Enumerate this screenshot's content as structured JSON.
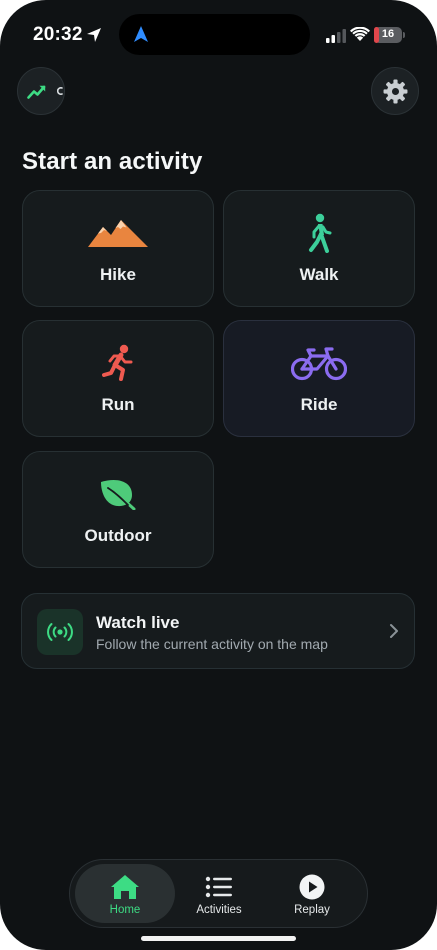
{
  "status_bar": {
    "time": "20:32",
    "battery_level": "16",
    "battery_fraction": 0.16
  },
  "header": {
    "stats_icon": "trend-up-icon",
    "settings_icon": "gear-icon"
  },
  "section_title": "Start an activity",
  "activities": [
    {
      "label": "Hike",
      "icon": "mountains-icon",
      "color": "#e9853f"
    },
    {
      "label": "Walk",
      "icon": "walking-person-icon",
      "color": "#3ccf9a"
    },
    {
      "label": "Run",
      "icon": "running-person-icon",
      "color": "#ef5a50"
    },
    {
      "label": "Ride",
      "icon": "bicycle-icon",
      "color": "#8b6cf0"
    },
    {
      "label": "Outdoor",
      "icon": "leaf-icon",
      "color": "#4ecb7a"
    }
  ],
  "watch_live": {
    "title": "Watch live",
    "subtitle": "Follow the current activity on the map",
    "icon": "broadcast-icon"
  },
  "tabbar": {
    "tabs": [
      {
        "label": "Home",
        "icon": "house-icon",
        "active": true
      },
      {
        "label": "Activities",
        "icon": "list-icon",
        "active": false
      },
      {
        "label": "Replay",
        "icon": "play-circle-icon",
        "active": false
      }
    ]
  },
  "colors": {
    "background": "#0f1214",
    "accent": "#3ddc84",
    "card": "#161b1d"
  }
}
